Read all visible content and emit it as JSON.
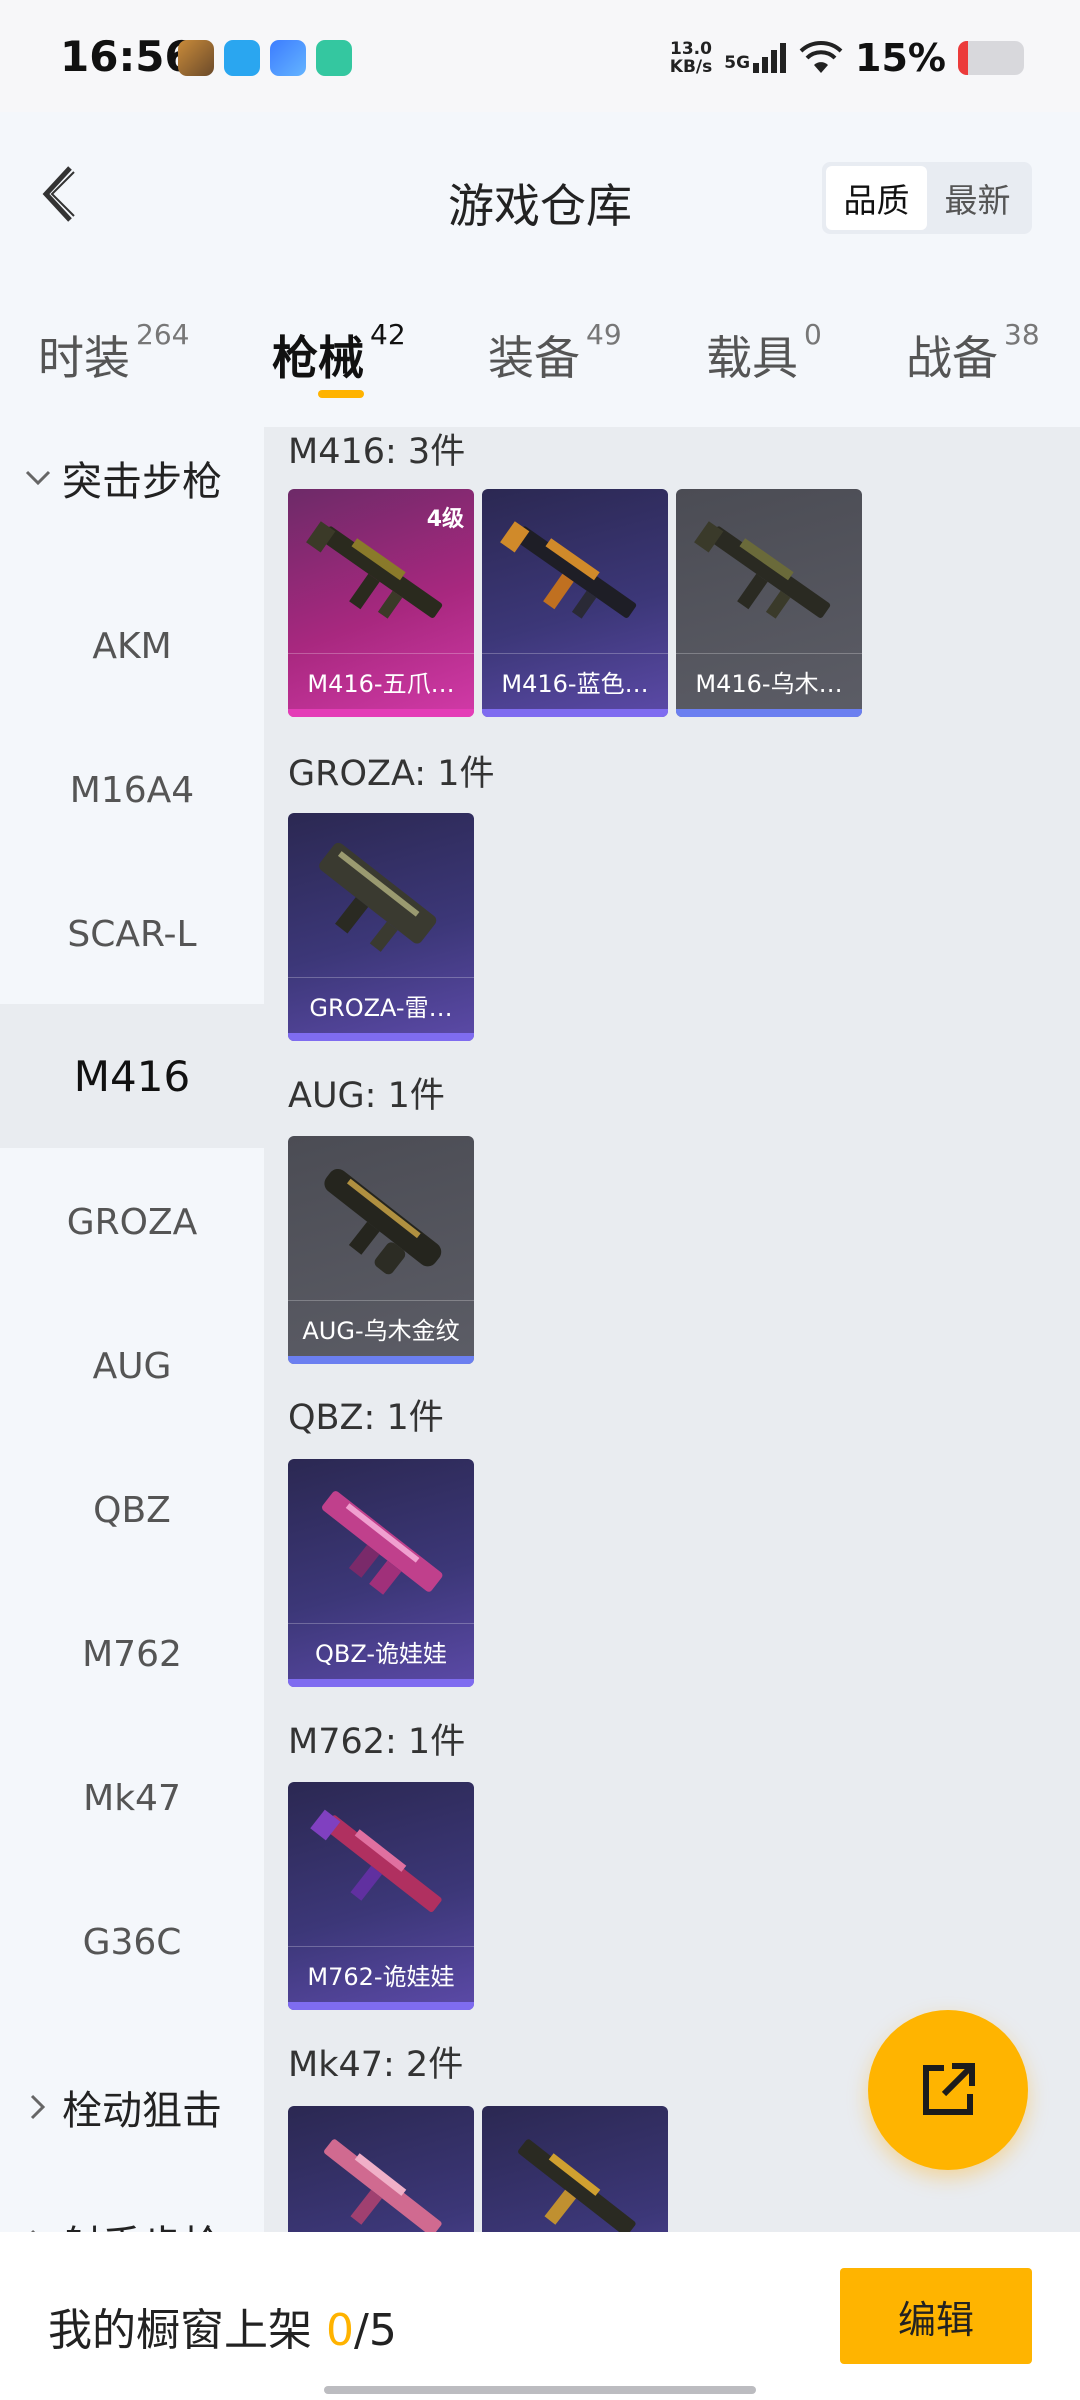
{
  "status_bar": {
    "time": "16:56",
    "net_speed_value": "13.0",
    "net_speed_unit": "KB/s",
    "network": "5G",
    "battery_percent": "15%",
    "battery_level": 0.15,
    "app_icons": [
      "game-app-icon",
      "chat-app-icon",
      "cloud-app-icon",
      "shield-app-icon"
    ]
  },
  "header": {
    "title": "游戏仓库",
    "sort_options": [
      "品质",
      "最新"
    ],
    "sort_selected": "品质"
  },
  "tabs": [
    {
      "label": "时装",
      "count": "264"
    },
    {
      "label": "枪械",
      "count": "42",
      "active": true
    },
    {
      "label": "装备",
      "count": "49"
    },
    {
      "label": "载具",
      "count": "0"
    },
    {
      "label": "战备",
      "count": "38"
    }
  ],
  "sidebar": {
    "groups": [
      {
        "label": "突击步枪",
        "expanded": true
      },
      {
        "label": "栓动狙击",
        "expanded": false
      },
      {
        "label": "射手步枪",
        "expanded": false
      }
    ],
    "items": [
      "AKM",
      "M16A4",
      "SCAR-L",
      "M416",
      "GROZA",
      "AUG",
      "QBZ",
      "M762",
      "Mk47",
      "G36C"
    ],
    "selected": "M416"
  },
  "sections": [
    {
      "title": "M416: 3件",
      "cards": [
        {
          "name": "M416-五爪…",
          "level": "4级",
          "quality": "pink"
        },
        {
          "name": "M416-蓝色…",
          "quality": "purple"
        },
        {
          "name": "M416-乌木…",
          "quality": "gray"
        }
      ]
    },
    {
      "title": "GROZA: 1件",
      "cards": [
        {
          "name": "GROZA-雷…",
          "quality": "purple"
        }
      ]
    },
    {
      "title": "AUG: 1件",
      "cards": [
        {
          "name": "AUG-乌木金纹",
          "quality": "gray"
        }
      ]
    },
    {
      "title": "QBZ: 1件",
      "cards": [
        {
          "name": "QBZ-诡娃娃",
          "quality": "purple"
        }
      ]
    },
    {
      "title": "M762: 1件",
      "cards": [
        {
          "name": "M762-诡娃娃",
          "quality": "purple"
        }
      ]
    },
    {
      "title": "Mk47: 2件",
      "cards": [
        {
          "name": "",
          "quality": "purple"
        },
        {
          "name": "",
          "quality": "purple"
        }
      ]
    }
  ],
  "bottom_bar": {
    "showcase_label": "我的橱窗上架",
    "showcase_count": "0",
    "showcase_separator": "/",
    "showcase_max": "5",
    "edit_label": "编辑"
  },
  "fab_icon": "share-icon",
  "colors": {
    "accent": "#ffb400",
    "quality_pink": "#d23aa8",
    "quality_purple": "#5c4aa8",
    "quality_gray": "#5c5d66"
  }
}
